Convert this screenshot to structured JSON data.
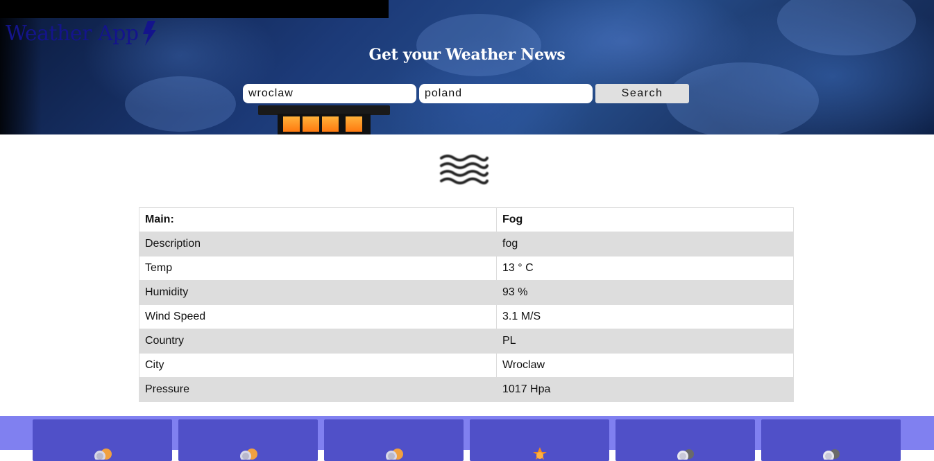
{
  "header": {
    "brand": "Weather App",
    "brand_icon": "lightning-bolt-icon",
    "title": "Get your Weather News"
  },
  "search": {
    "city_value": "wroclaw",
    "country_value": "poland",
    "button_label": "Search"
  },
  "current": {
    "icon": "fog-icon",
    "rows": [
      {
        "label": "Main:",
        "value": "Fog"
      },
      {
        "label": "Description",
        "value": "fog"
      },
      {
        "label": "Temp",
        "value": "13 ° C"
      },
      {
        "label": "Humidity",
        "value": "93 %"
      },
      {
        "label": "Wind Speed",
        "value": "3.1 M/S"
      },
      {
        "label": "Country",
        "value": "PL"
      },
      {
        "label": "City",
        "value": "Wroclaw"
      },
      {
        "label": "Pressure",
        "value": "1017 Hpa"
      }
    ]
  },
  "forecast": {
    "cards": [
      {
        "icon": "partly-cloudy-icon"
      },
      {
        "icon": "partly-cloudy-icon"
      },
      {
        "icon": "partly-cloudy-icon"
      },
      {
        "icon": "sun-icon"
      },
      {
        "icon": "cloudy-icon"
      },
      {
        "icon": "cloudy-icon"
      }
    ]
  },
  "colors": {
    "brand": "#14148c",
    "forecast_bg": "#8080f0",
    "card_bg": "#5050c8",
    "row_alt": "#dddddd"
  }
}
